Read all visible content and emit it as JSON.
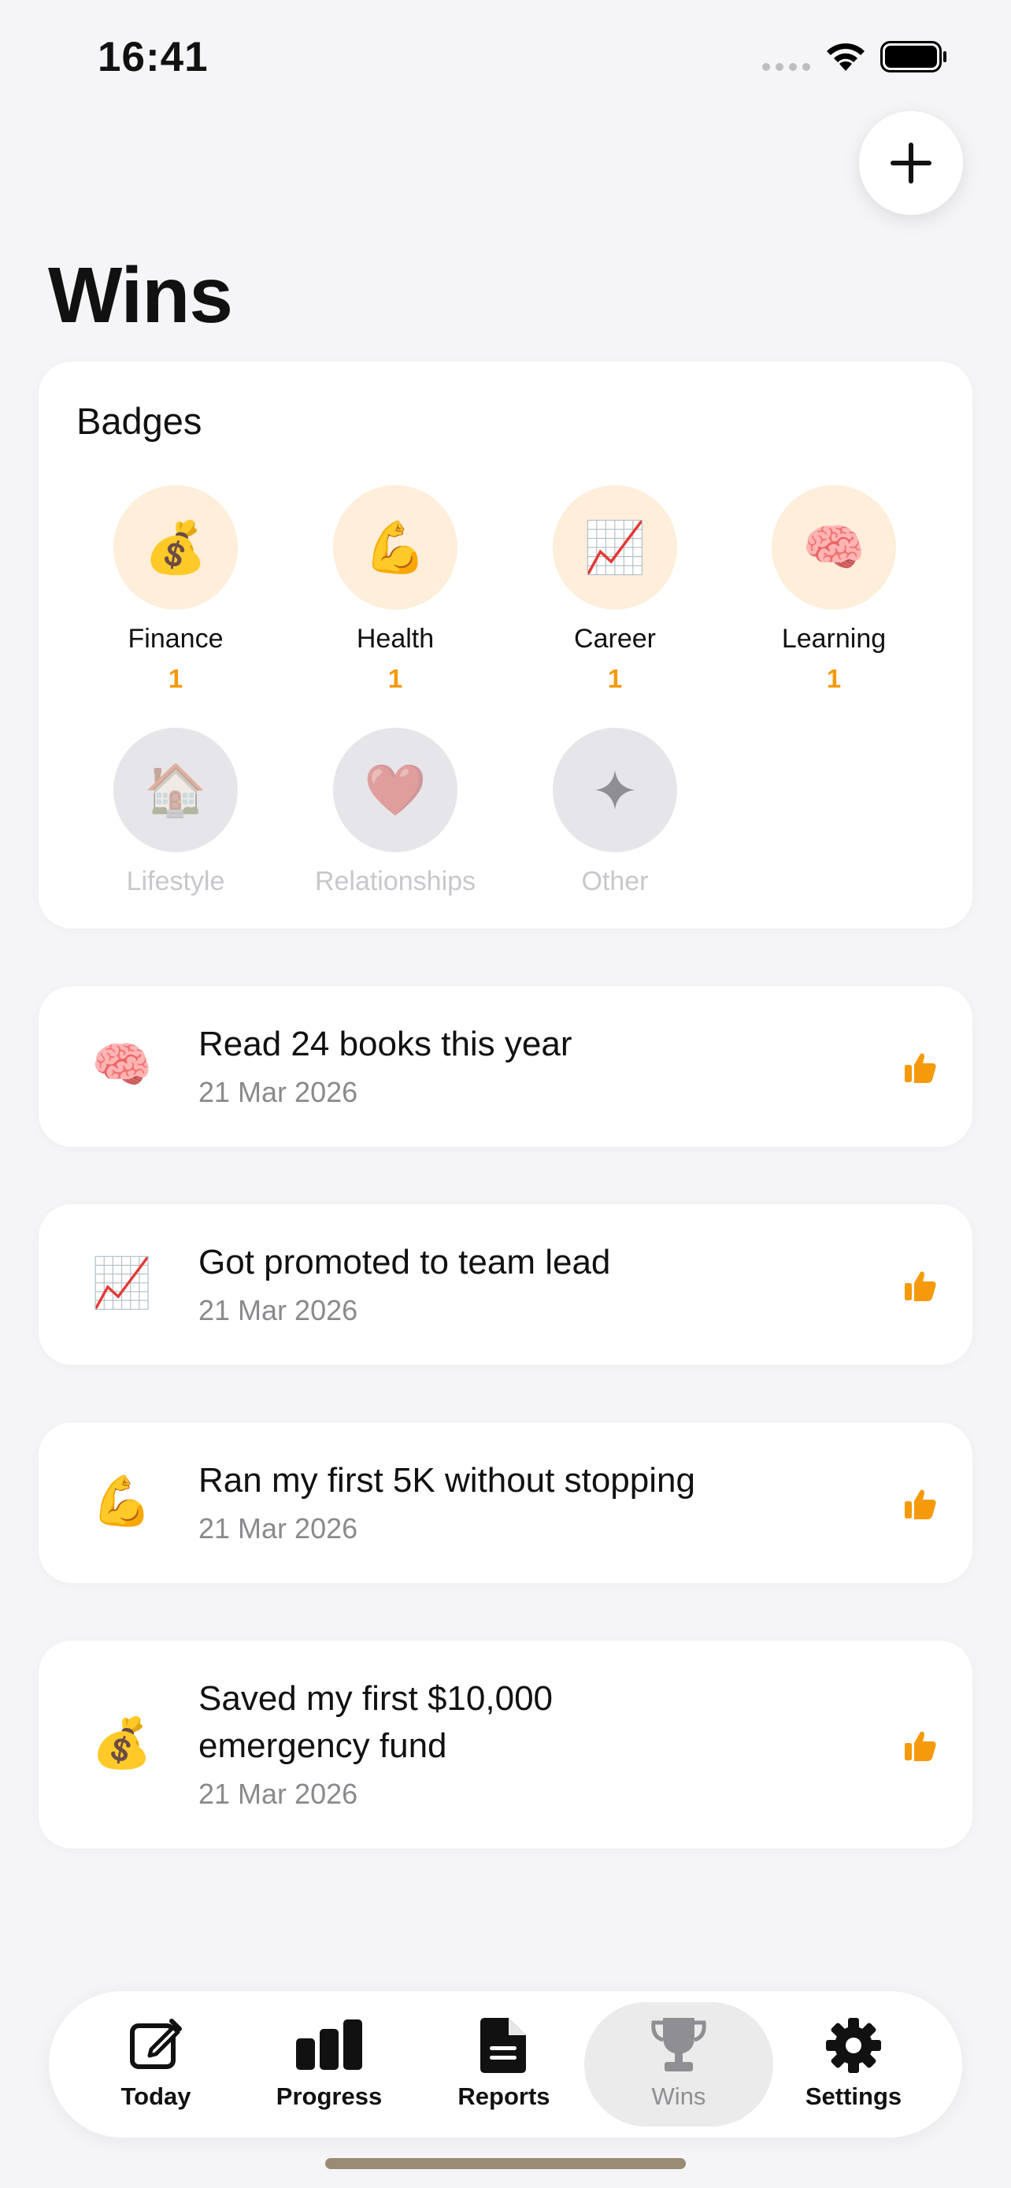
{
  "status_bar": {
    "time": "16:41"
  },
  "page": {
    "title": "Wins"
  },
  "badges": {
    "title": "Badges",
    "items": [
      {
        "name": "Finance",
        "emoji": "💰",
        "count": "1",
        "earned": true
      },
      {
        "name": "Health",
        "emoji": "💪",
        "count": "1",
        "earned": true
      },
      {
        "name": "Career",
        "emoji": "📈",
        "count": "1",
        "earned": true
      },
      {
        "name": "Learning",
        "emoji": "🧠",
        "count": "1",
        "earned": true
      },
      {
        "name": "Lifestyle",
        "emoji": "🏠",
        "earned": false
      },
      {
        "name": "Relationships",
        "emoji": "❤️",
        "earned": false
      },
      {
        "name": "Other",
        "emoji": "✦",
        "earned": false
      }
    ]
  },
  "wins": [
    {
      "emoji": "🧠",
      "title": "Read 24 books this year",
      "date": "21 Mar 2026"
    },
    {
      "emoji": "📈",
      "title": "Got promoted to team lead",
      "date": "21 Mar 2026"
    },
    {
      "emoji": "💪",
      "title": "Ran my first 5K without stopping",
      "date": "21 Mar 2026"
    },
    {
      "emoji": "💰",
      "title_line1": "Saved my first $10,000",
      "title_line2": "emergency fund",
      "date": "21 Mar 2026"
    }
  ],
  "tab_bar": {
    "active": "Wins",
    "tabs": [
      {
        "label": "Today",
        "icon": "compose-icon"
      },
      {
        "label": "Progress",
        "icon": "bar-chart-icon"
      },
      {
        "label": "Reports",
        "icon": "document-icon"
      },
      {
        "label": "Wins",
        "icon": "trophy-icon"
      },
      {
        "label": "Settings",
        "icon": "gear-icon"
      }
    ]
  },
  "colors": {
    "accent": "#F59A0A",
    "badge_earned_bg": "#FEEEDA",
    "badge_locked_bg": "#E6E5EA",
    "background": "#F5F4F6"
  }
}
